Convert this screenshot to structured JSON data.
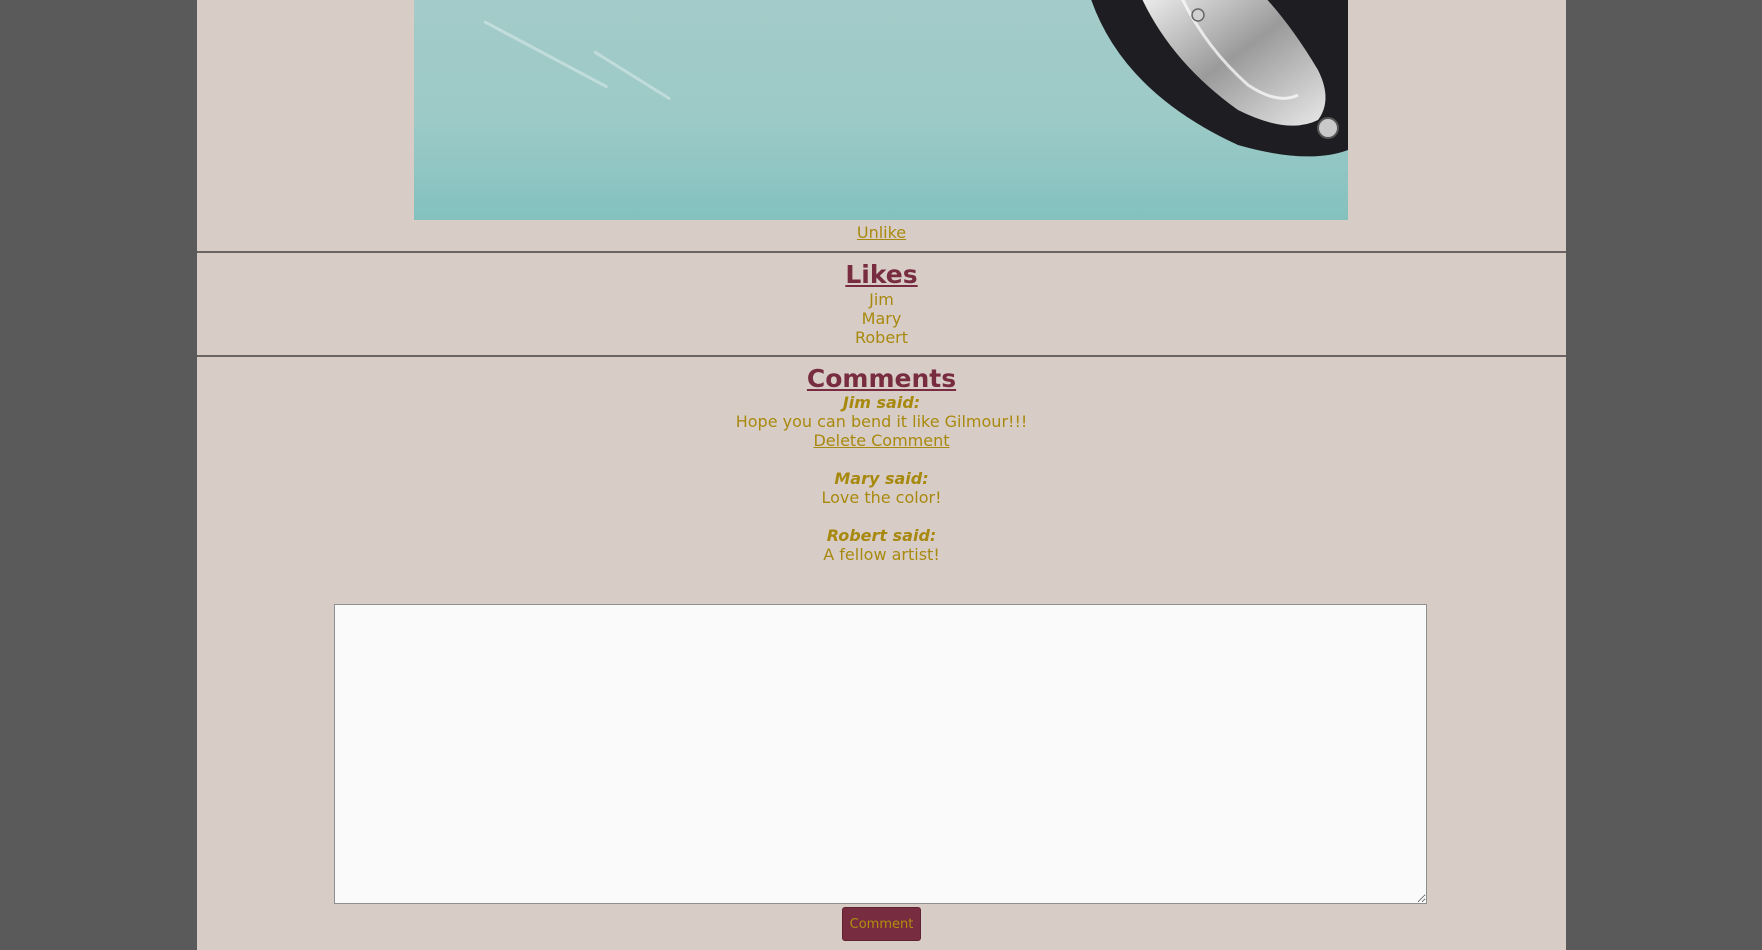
{
  "post": {
    "unlike_label": "Unlike"
  },
  "likes": {
    "title": "Likes",
    "users": [
      "Jim",
      "Mary",
      "Robert"
    ]
  },
  "comments": {
    "title": "Comments",
    "items": [
      {
        "author": "Jim said:",
        "text": "Hope you can bend it like Gilmour!!!",
        "delete_label": "Delete Comment"
      },
      {
        "author": "Mary said:",
        "text": "Love the color!"
      },
      {
        "author": "Robert said:",
        "text": "A fellow artist!"
      }
    ]
  },
  "form": {
    "textarea_value": "",
    "submit_label": "Comment"
  },
  "colors": {
    "outer_background": "#5a5a5a",
    "page_background": "#d8cdc6",
    "text_gold": "#a8890f",
    "heading_maroon": "#782c3f",
    "button_background": "#782c3f"
  }
}
